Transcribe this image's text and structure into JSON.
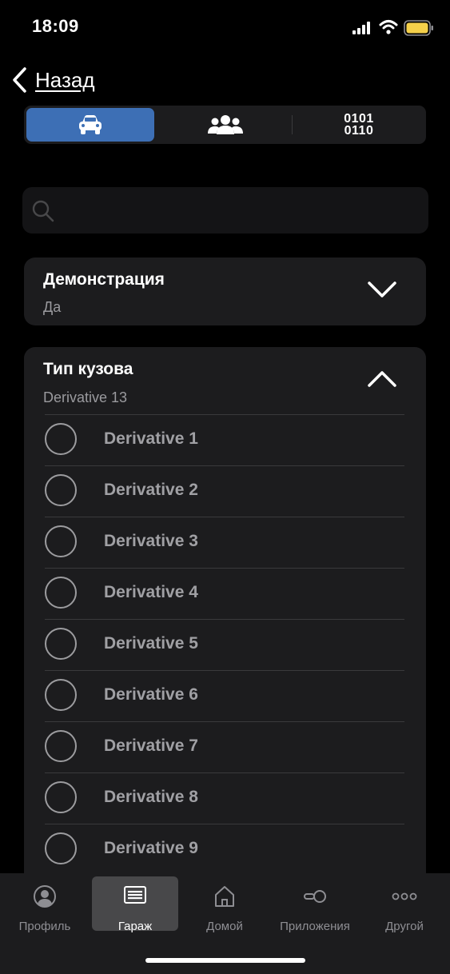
{
  "status": {
    "time": "18:09"
  },
  "nav": {
    "back_label": "Назад"
  },
  "segments": {
    "items": [
      {
        "icon": "car-icon",
        "active": true
      },
      {
        "icon": "people-icon",
        "active": false
      },
      {
        "icon": "binary-icon",
        "line1": "0101",
        "line2": "0110",
        "active": false
      }
    ]
  },
  "search": {
    "placeholder": ""
  },
  "filters": {
    "demo": {
      "title": "Демонстрация",
      "value": "Да"
    },
    "body_type": {
      "title": "Тип кузова",
      "value": "Derivative 13",
      "options": [
        "Derivative 1",
        "Derivative 2",
        "Derivative 3",
        "Derivative 4",
        "Derivative 5",
        "Derivative 6",
        "Derivative 7",
        "Derivative 8",
        "Derivative 9"
      ]
    }
  },
  "tabbar": {
    "items": [
      {
        "label": "Профиль",
        "icon": "profile-icon"
      },
      {
        "label": "Гараж",
        "icon": "garage-icon",
        "active": true
      },
      {
        "label": "Домой",
        "icon": "home-icon"
      },
      {
        "label": "Приложения",
        "icon": "apps-icon"
      },
      {
        "label": "Другой",
        "icon": "more-icon"
      }
    ]
  },
  "colors": {
    "accent": "#3d6fb5",
    "card": "#1c1c1e",
    "background": "#000000"
  }
}
